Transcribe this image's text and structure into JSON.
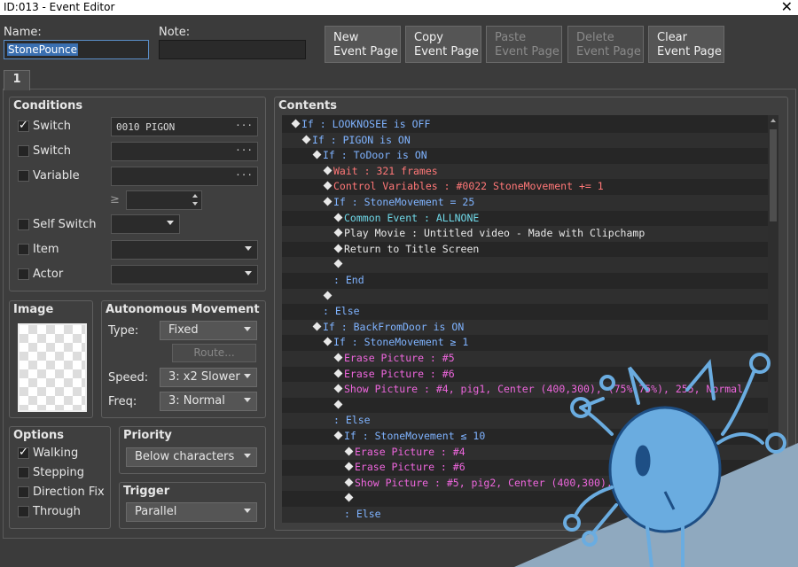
{
  "window": {
    "title": "ID:013 - Event Editor",
    "close": "✕"
  },
  "labels": {
    "name": "Name:",
    "note": "Note:"
  },
  "name_value": "StonePounce",
  "note_value": "",
  "buttons": {
    "new": [
      "New",
      "Event Page"
    ],
    "copy": [
      "Copy",
      "Event Page"
    ],
    "paste": [
      "Paste",
      "Event Page"
    ],
    "delete": [
      "Delete",
      "Event Page"
    ],
    "clear": [
      "Clear",
      "Event Page"
    ]
  },
  "tab": "1",
  "conditions": {
    "title": "Conditions",
    "switch1": {
      "label": "Switch",
      "checked": true,
      "value": "0010 PIGON"
    },
    "switch2": {
      "label": "Switch",
      "checked": false,
      "value": ""
    },
    "variable": {
      "label": "Variable",
      "checked": false,
      "value": "",
      "op": "≥"
    },
    "self_switch": {
      "label": "Self Switch",
      "checked": false
    },
    "item": {
      "label": "Item",
      "checked": false
    },
    "actor": {
      "label": "Actor",
      "checked": false
    }
  },
  "image": {
    "title": "Image"
  },
  "movement": {
    "title": "Autonomous Movement",
    "type_label": "Type:",
    "type_value": "Fixed",
    "route": "Route...",
    "speed_label": "Speed:",
    "speed_value": "3: x2 Slower",
    "freq_label": "Freq:",
    "freq_value": "3: Normal"
  },
  "options": {
    "title": "Options",
    "items": [
      {
        "label": "Walking",
        "checked": true
      },
      {
        "label": "Stepping",
        "checked": false
      },
      {
        "label": "Direction Fix",
        "checked": false
      },
      {
        "label": "Through",
        "checked": false
      }
    ]
  },
  "priority": {
    "title": "Priority",
    "value": "Below characters"
  },
  "trigger": {
    "title": "Trigger",
    "value": "Parallel"
  },
  "contents": {
    "title": "Contents",
    "lines": [
      {
        "indent": 0,
        "d": true,
        "c": "c-blue",
        "t": "If : LOOKNOSEE is OFF"
      },
      {
        "indent": 1,
        "d": true,
        "c": "c-blue",
        "t": "If : PIGON is ON"
      },
      {
        "indent": 2,
        "d": true,
        "c": "c-blue",
        "t": "If : ToDoor is ON"
      },
      {
        "indent": 3,
        "d": true,
        "c": "c-red",
        "t": "Wait : 321 frames"
      },
      {
        "indent": 3,
        "d": true,
        "c": "c-red",
        "t": "Control Variables : #0022 StoneMovement += 1"
      },
      {
        "indent": 3,
        "d": true,
        "c": "c-blue",
        "t": "If : StoneMovement = 25"
      },
      {
        "indent": 4,
        "d": true,
        "c": "c-cyan",
        "t": "Common Event : ALLNONE"
      },
      {
        "indent": 4,
        "d": true,
        "c": "c-white",
        "t": "Play Movie : Untitled video - Made with Clipchamp"
      },
      {
        "indent": 4,
        "d": true,
        "c": "c-white",
        "t": "Return to Title Screen"
      },
      {
        "indent": 4,
        "d": true,
        "c": "c-white",
        "t": ""
      },
      {
        "indent": 3,
        "d": false,
        "c": "c-blue",
        "t": ": End"
      },
      {
        "indent": 3,
        "d": true,
        "c": "c-white",
        "t": ""
      },
      {
        "indent": 2,
        "d": false,
        "c": "c-blue",
        "t": ": Else"
      },
      {
        "indent": 2,
        "d": true,
        "c": "c-blue",
        "t": "If : BackFromDoor is ON"
      },
      {
        "indent": 3,
        "d": true,
        "c": "c-blue",
        "t": "If : StoneMovement ≥ 1"
      },
      {
        "indent": 4,
        "d": true,
        "c": "c-pink",
        "t": "Erase Picture : #5"
      },
      {
        "indent": 4,
        "d": true,
        "c": "c-pink",
        "t": "Erase Picture : #6"
      },
      {
        "indent": 4,
        "d": true,
        "c": "c-pink",
        "t": "Show Picture : #4, pig1, Center (400,300), (75%,75%), 255, Normal"
      },
      {
        "indent": 4,
        "d": true,
        "c": "c-white",
        "t": ""
      },
      {
        "indent": 3,
        "d": false,
        "c": "c-blue",
        "t": ": Else"
      },
      {
        "indent": 4,
        "d": true,
        "c": "c-blue",
        "t": "If : StoneMovement ≤ 10"
      },
      {
        "indent": 5,
        "d": true,
        "c": "c-pink",
        "t": "Erase Picture : #4"
      },
      {
        "indent": 5,
        "d": true,
        "c": "c-pink",
        "t": "Erase Picture : #6"
      },
      {
        "indent": 5,
        "d": true,
        "c": "c-pink",
        "t": "Show Picture : #5, pig2, Center (400,300), (75%,75%), 255, Normal"
      },
      {
        "indent": 5,
        "d": true,
        "c": "c-white",
        "t": ""
      },
      {
        "indent": 4,
        "d": false,
        "c": "c-blue",
        "t": ": Else"
      }
    ]
  },
  "colors": {
    "accent": "#5a8ec8",
    "panel": "#3f3f3f",
    "mascot": "#6aace0",
    "mascot_dark": "#1e4f85"
  }
}
